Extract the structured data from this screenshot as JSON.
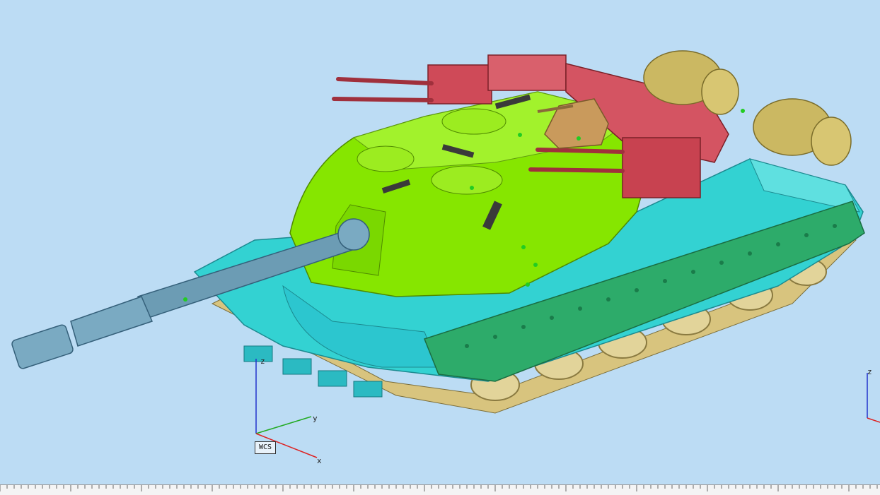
{
  "viewport": {
    "background": "#bcdcf4",
    "model": "tank-3d-model"
  },
  "triad_main": {
    "label_box": "WCS",
    "x": "x",
    "y": "y",
    "z": "z"
  },
  "triad_corner": {
    "z": "z"
  },
  "colors": {
    "gun": "#6c9cb4",
    "turret": "#86e600",
    "hull": "#33d2d2",
    "side_skirt": "#2dab6a",
    "tracks": "#d8c47e",
    "launchers": "#cf4a58",
    "drums": "#cbb862",
    "mount": "#c99a5c"
  }
}
